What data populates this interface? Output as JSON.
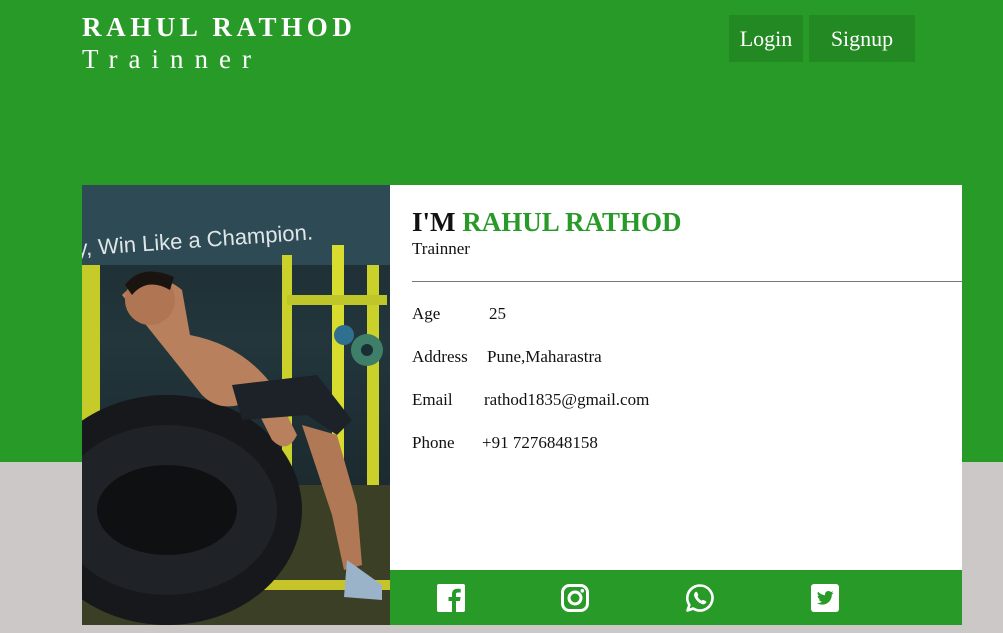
{
  "brand": {
    "name": "RAHUL RATHOD",
    "subtitle": "Trainner"
  },
  "nav": {
    "login_label": "Login",
    "signup_label": "Signup"
  },
  "profile": {
    "greeting": "I'M",
    "name": "RAHUL RATHOD",
    "role": "Trainner",
    "photo_banner_text": "y, Win Like a Champion.",
    "details": [
      {
        "label": "Age",
        "value": "25"
      },
      {
        "label": "Address",
        "value": "Pune,Maharastra"
      },
      {
        "label": "Email",
        "value": "rathod1835@gmail.com"
      },
      {
        "label": "Phone",
        "value": "+91 7276848158"
      }
    ]
  },
  "social": [
    "facebook-icon",
    "instagram-icon",
    "whatsapp-icon",
    "twitter-icon"
  ],
  "colors": {
    "accent": "#289a28",
    "button": "#238a23",
    "lower_bg": "#cbc8c7"
  }
}
